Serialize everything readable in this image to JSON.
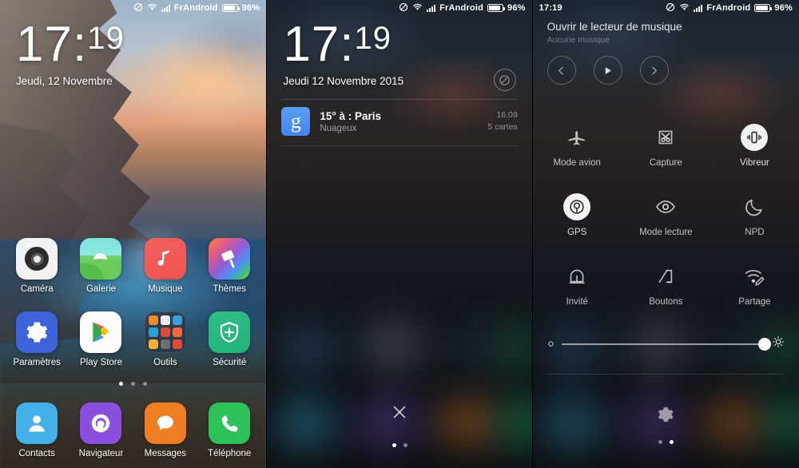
{
  "status_bar": {
    "carrier": "FrAndroid",
    "battery_pct": "96%",
    "clock": "17:19",
    "icons": [
      "dnd-icon",
      "wifi-icon",
      "signal-icon",
      "battery-icon"
    ]
  },
  "panel1_home": {
    "clock_hours": "17",
    "clock_separator": ":",
    "clock_minutes": "19",
    "date": "Jeudi, 12 Novembre",
    "apps": [
      {
        "label": "Caméra",
        "icon": "camera-icon"
      },
      {
        "label": "Galerie",
        "icon": "gallery-icon"
      },
      {
        "label": "Musique",
        "icon": "music-note-icon"
      },
      {
        "label": "Thèmes",
        "icon": "paint-roller-icon"
      },
      {
        "label": "Paramètres",
        "icon": "gear-icon"
      },
      {
        "label": "Play Store",
        "icon": "play-store-icon"
      },
      {
        "label": "Outils",
        "icon": "folder-tools-icon"
      },
      {
        "label": "Sécurité",
        "icon": "shield-plus-icon"
      }
    ],
    "dock": [
      {
        "label": "Contacts",
        "icon": "person-icon"
      },
      {
        "label": "Navigateur",
        "icon": "browser-icon"
      },
      {
        "label": "Messages",
        "icon": "speech-bubble-icon"
      },
      {
        "label": "Téléphone",
        "icon": "phone-handset-icon"
      }
    ],
    "page_dots": {
      "count": 3,
      "active": 0
    }
  },
  "panel2_lockscreen": {
    "clock_hours": "17",
    "clock_separator": ":",
    "clock_minutes": "19",
    "date": "Jeudi 12 Novembre 2015",
    "dnd_button": "do-not-disturb-icon",
    "notification": {
      "app_icon_letter": "g",
      "title": "15° à : Paris",
      "subtitle": "Nuageux",
      "time": "16.09",
      "count": "5 cartes"
    },
    "close_button": "close-icon",
    "page_dots": {
      "count": 2,
      "active": 0
    }
  },
  "panel3_quicksettings": {
    "music_player": {
      "title": "Ouvrir le lecteur de musique",
      "subtitle": "Aucune musique",
      "controls": [
        "previous-icon",
        "play-icon",
        "next-icon"
      ]
    },
    "toggles": [
      {
        "label": "Mode avion",
        "icon": "airplane-icon",
        "active": false
      },
      {
        "label": "Capture",
        "icon": "scissors-icon",
        "active": false
      },
      {
        "label": "Vibreur",
        "icon": "vibrate-icon",
        "active": true
      },
      {
        "label": "GPS",
        "icon": "location-icon",
        "active": true
      },
      {
        "label": "Mode lecture",
        "icon": "eye-icon",
        "active": false
      },
      {
        "label": "NPD",
        "icon": "moon-icon",
        "active": false
      },
      {
        "label": "Invité",
        "icon": "guest-icon",
        "active": false
      },
      {
        "label": "Boutons",
        "icon": "buttons-icon",
        "active": false
      },
      {
        "label": "Partage",
        "icon": "hotspot-icon",
        "active": false
      }
    ],
    "brightness": {
      "min_icon": "brightness-low-icon",
      "max_icon": "brightness-high-icon",
      "value": 93
    },
    "settings_button": "gear-icon",
    "page_dots": {
      "count": 2,
      "active": 1
    }
  },
  "colors": {
    "accent_blue": "#4285f4",
    "camera": "#f2f2f2",
    "gallery_top": "#7fe3e0",
    "gallery_bottom": "#53c14f",
    "music": "#ef5350",
    "settings": "#3f63d8",
    "security": "#2fbf86",
    "contacts": "#43b0e8",
    "navigator": "#8b4fe0",
    "messages": "#ef7d22",
    "phone": "#2cc159"
  }
}
